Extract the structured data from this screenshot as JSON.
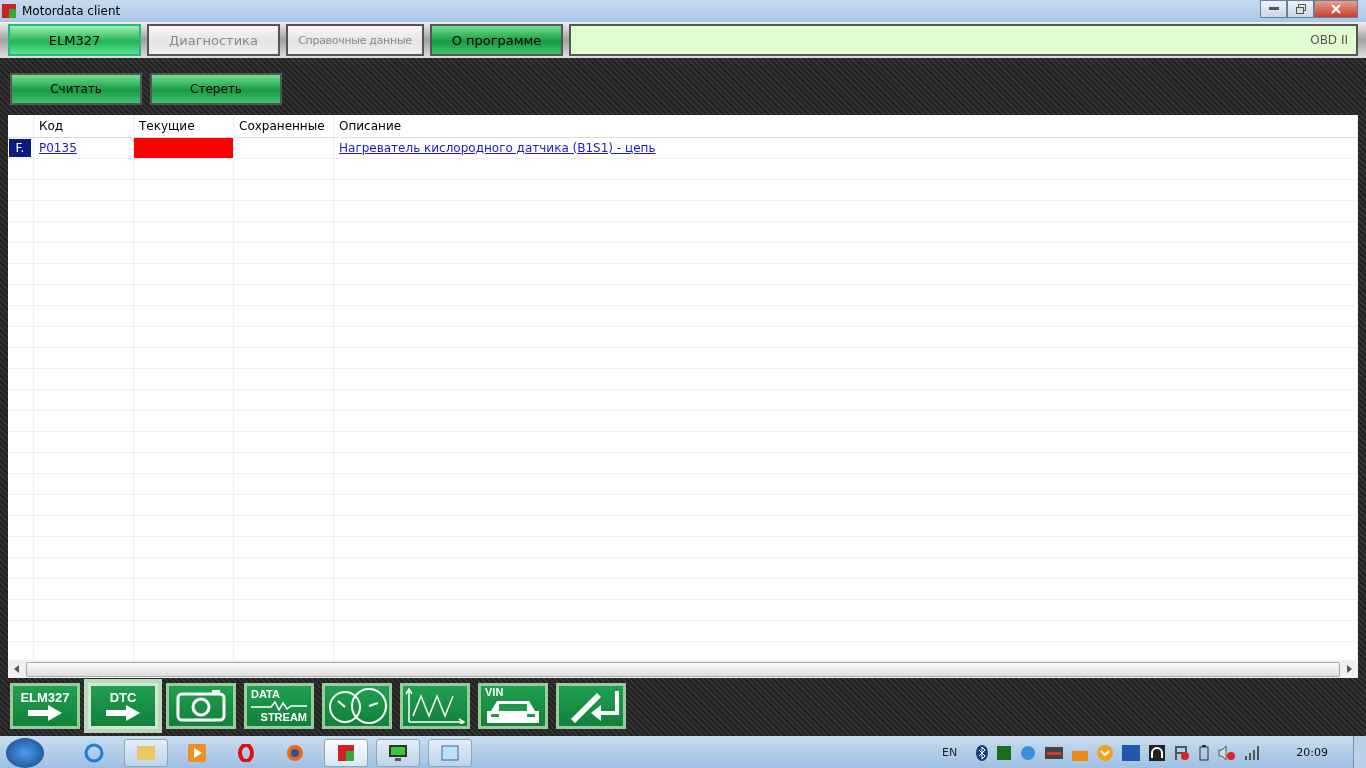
{
  "window": {
    "title": "Motordata client"
  },
  "tabs": [
    {
      "label": "ELM327",
      "disabled": false,
      "selected": true
    },
    {
      "label": "Диагностика",
      "disabled": true,
      "selected": false
    },
    {
      "label": "Справочные данные",
      "disabled": true,
      "selected": false
    },
    {
      "label": "О программе",
      "disabled": false,
      "selected": false
    }
  ],
  "protocol": "OBD II",
  "actions": [
    "Считать",
    "Стереть"
  ],
  "table": {
    "columns": [
      "Код",
      "Текущие",
      "Сохраненные",
      "Описание"
    ],
    "rows": [
      {
        "marker": "F.",
        "code": "P0135",
        "current": true,
        "saved": false,
        "description": "Нагреватель кислородного датчика (B1S1) - цепь"
      }
    ]
  },
  "tools": [
    {
      "kind": "arrow",
      "label": "ELM327",
      "selected": false
    },
    {
      "kind": "arrow",
      "label": "DTC",
      "selected": true
    },
    {
      "kind": "camera",
      "selected": false
    },
    {
      "kind": "stream",
      "label": "DATA",
      "label2": "STREAM",
      "selected": false
    },
    {
      "kind": "gauges",
      "selected": false
    },
    {
      "kind": "graph",
      "selected": false
    },
    {
      "kind": "vin",
      "label": "VIN",
      "selected": false
    },
    {
      "kind": "injector",
      "selected": false
    }
  ],
  "taskbar": {
    "language": "EN",
    "time": "20:09"
  }
}
